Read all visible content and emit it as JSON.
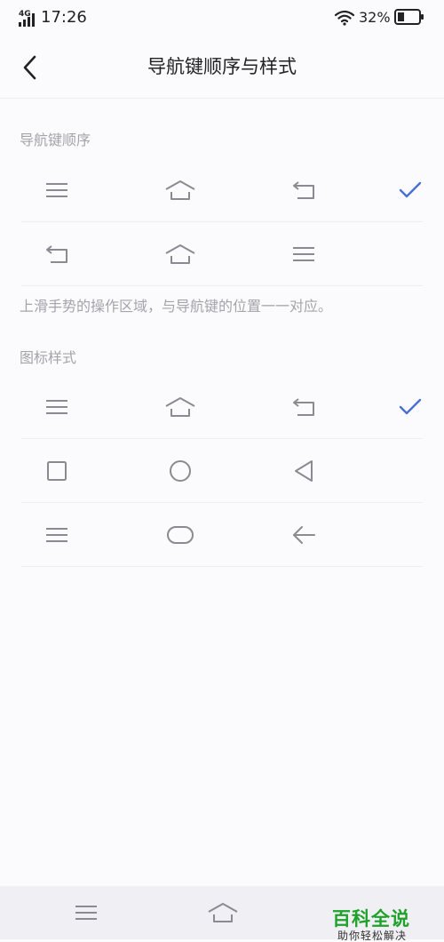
{
  "status_bar": {
    "network": "4G",
    "time": "17:26",
    "battery_percent": "32%",
    "battery_level": 0.32,
    "icons": [
      "signal-icon",
      "wifi-icon",
      "battery-icon"
    ]
  },
  "header": {
    "title": "导航键顺序与样式",
    "back_icon": "chevron-left-icon"
  },
  "nav_order_section": {
    "label": "导航键顺序",
    "options": [
      {
        "icons": [
          "menu-icon",
          "home-icon",
          "back-icon"
        ],
        "selected": true
      },
      {
        "icons": [
          "back-icon",
          "home-icon",
          "menu-icon"
        ],
        "selected": false
      }
    ],
    "hint": "上滑手势的操作区域，与导航键的位置一一对应。"
  },
  "icon_style_section": {
    "label": "图标样式",
    "options": [
      {
        "icons": [
          "menu-icon",
          "home-icon",
          "back-icon"
        ],
        "selected": true
      },
      {
        "icons": [
          "square-icon",
          "circle-icon",
          "triangle-back-icon"
        ],
        "selected": false
      },
      {
        "icons": [
          "menu-icon",
          "rounded-rect-icon",
          "arrow-left-icon"
        ],
        "selected": false
      }
    ]
  },
  "bottom_nav": {
    "icons": [
      "menu-icon",
      "home-icon"
    ]
  },
  "watermark": {
    "main": "百科全说",
    "sub": "助你轻松解决"
  },
  "colors": {
    "accent": "#4a6fd3",
    "icon": "#8a8a92",
    "label": "#a4a4ab",
    "background": "#fbfbfd",
    "nav_bar": "#efeff4",
    "watermark": "#1fa12a"
  }
}
